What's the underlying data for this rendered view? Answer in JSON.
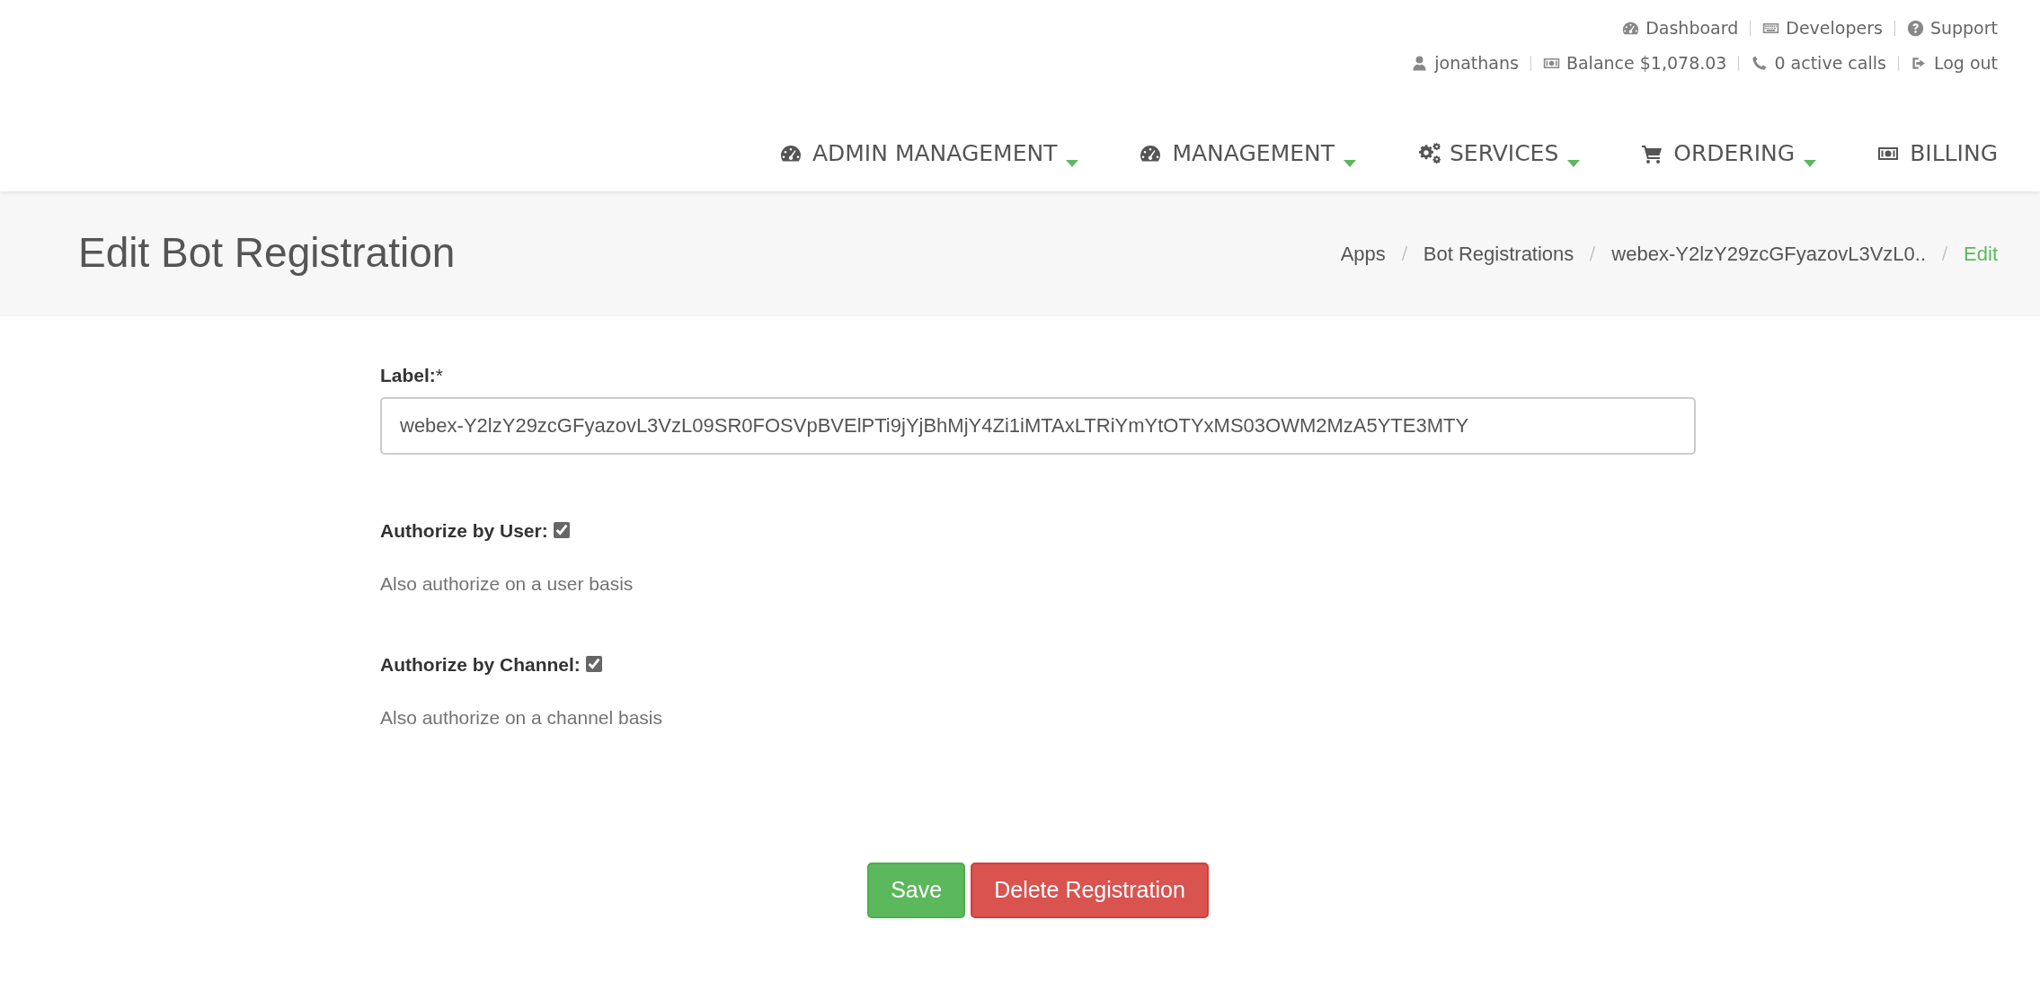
{
  "top_links": {
    "site_links": [
      {
        "label": "Dashboard"
      },
      {
        "label": "Developers"
      },
      {
        "label": "Support"
      }
    ],
    "account_links": [
      {
        "label": "jonathans"
      },
      {
        "label": "Balance $1,078.03"
      },
      {
        "label": "0 active calls"
      },
      {
        "label": "Log out"
      }
    ]
  },
  "nav": [
    {
      "label": "ADMIN MANAGEMENT",
      "has_dropdown": true
    },
    {
      "label": "MANAGEMENT",
      "has_dropdown": true
    },
    {
      "label": "SERVICES",
      "has_dropdown": true
    },
    {
      "label": "ORDERING",
      "has_dropdown": true
    },
    {
      "label": "BILLING",
      "has_dropdown": false
    }
  ],
  "page_title": "Edit Bot Registration",
  "breadcrumb": [
    {
      "label": "Apps",
      "active": false
    },
    {
      "label": "Bot Registrations",
      "active": false
    },
    {
      "label": "webex-Y2lzY29zcGFyazovL3VzL0..",
      "active": false
    },
    {
      "label": "Edit",
      "active": true
    }
  ],
  "form": {
    "label_field": {
      "label": "Label:",
      "required_mark": "*",
      "value": "webex-Y2lzY29zcGFyazovL3VzL09SR0FOSVpBVElPTi9jYjBhMjY4Zi1iMTAxLTRiYmYtOTYxMS03OWM2MzA5YTE3MTY"
    },
    "checkboxes": [
      {
        "label": "Authorize by User:",
        "checked": true,
        "help": "Also authorize on a user basis"
      },
      {
        "label": "Authorize by Channel:",
        "checked": true,
        "help": "Also authorize on a channel basis"
      }
    ],
    "buttons": [
      {
        "label": "Save",
        "kind": "success"
      },
      {
        "label": "Delete Registration",
        "kind": "danger"
      }
    ]
  }
}
